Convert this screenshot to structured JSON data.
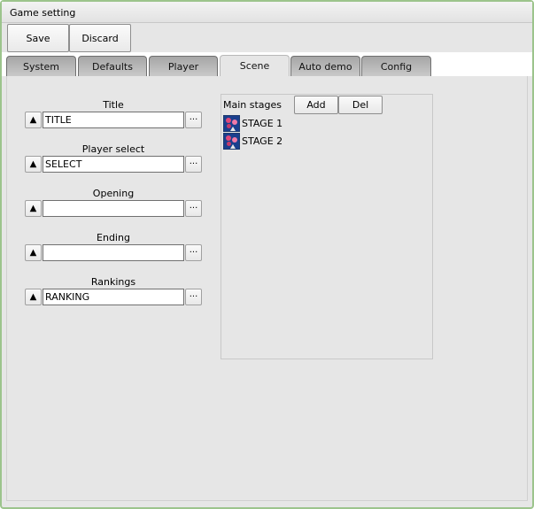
{
  "window": {
    "title": "Game setting"
  },
  "toolbar": {
    "save_label": "Save",
    "discard_label": "Discard"
  },
  "tabs": [
    {
      "label": "System"
    },
    {
      "label": "Defaults"
    },
    {
      "label": "Player"
    },
    {
      "label": "Scene"
    },
    {
      "label": "Auto demo"
    },
    {
      "label": "Config"
    }
  ],
  "active_tab": "Scene",
  "scenes": [
    {
      "label": "Title",
      "value": "TITLE",
      "arrow_glyph": "▲",
      "browse_glyph": "···"
    },
    {
      "label": "Player select",
      "value": "SELECT",
      "arrow_glyph": "▲",
      "browse_glyph": "···"
    },
    {
      "label": "Opening",
      "value": "",
      "arrow_glyph": "▲",
      "browse_glyph": "···"
    },
    {
      "label": "Ending",
      "value": "",
      "arrow_glyph": "▲",
      "browse_glyph": "···"
    },
    {
      "label": "Rankings",
      "value": "RANKING",
      "arrow_glyph": "▲",
      "browse_glyph": "···"
    }
  ],
  "stages": {
    "header": "Main stages",
    "add_label": "Add",
    "del_label": "Del",
    "items": [
      {
        "label": "STAGE 1",
        "icon": "stage-thumbnail-icon"
      },
      {
        "label": "STAGE 2",
        "icon": "stage-thumbnail-icon"
      }
    ]
  },
  "colors": {
    "window_border": "#9cc48c",
    "panel_bg": "#e6e6e6",
    "tab_inactive": "#b4b4b4",
    "stage_icon_bg": "#1a3f8e"
  }
}
